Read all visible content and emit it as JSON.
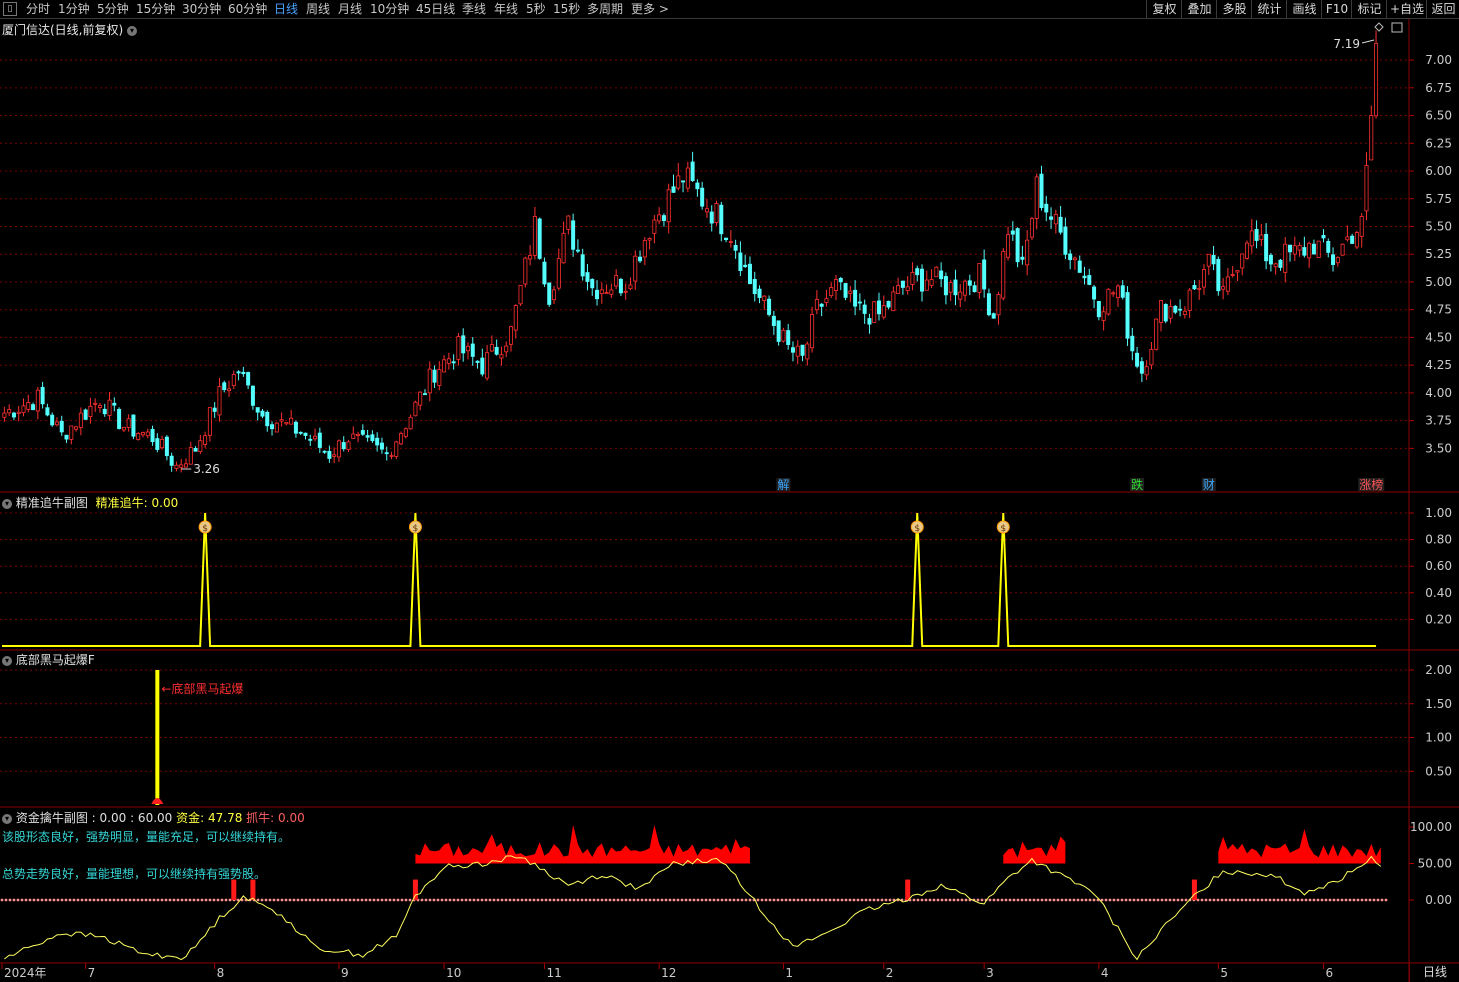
{
  "toolbar": {
    "periods": [
      "分时",
      "1分钟",
      "5分钟",
      "15分钟",
      "30分钟",
      "60分钟",
      "日线",
      "周线",
      "月线",
      "10分钟",
      "45日线",
      "季线",
      "年线",
      "5秒",
      "15秒",
      "多周期",
      "更多 >"
    ],
    "active_period": "日线",
    "right_buttons": [
      "复权",
      "叠加",
      "多股",
      "统计",
      "画线",
      "F10",
      "标记",
      "+自选",
      "返回"
    ]
  },
  "colors": {
    "up": "#ff3030",
    "down": "#54ffff",
    "grid": "#7a0000",
    "axis": "#8a0000",
    "yellow": "#ffff00",
    "indicator": "#ffff60",
    "white_line": "#e0e0e0"
  },
  "main_panel": {
    "title": "厦门信达(日线,前复权)",
    "high_label": "7.19",
    "low_label": "3.26",
    "event_badges": [
      {
        "text": "解",
        "index": 163,
        "color": "#3aa7ff"
      },
      {
        "text": "跌",
        "index": 237,
        "color": "#33dd33"
      },
      {
        "text": "财",
        "index": 252,
        "color": "#3aa7ff"
      },
      {
        "text": "涨榜",
        "index": 286,
        "color": "#ff5555"
      }
    ]
  },
  "panel2": {
    "title": "精准追牛副图",
    "indicator_label": "精准追牛: 0.00",
    "signal_icon": "money-bag-icon"
  },
  "panel3": {
    "title": "底部黑马起爆F",
    "annotation": "←底部黑马起爆"
  },
  "panel4": {
    "title": "资金擒牛副图",
    "v1": ": 0.00",
    "v2": ": 60.00",
    "capital_label": "资金: 47.78",
    "grab_label": "抓牛: 0.00",
    "comment1": "该股形态良好，强势明显，量能充足，可以继续持有。",
    "comment2": "总势走势良好，量能理想，可以继续持有强势股。"
  },
  "bottom_right_label": "日线",
  "chart_data": [
    {
      "type": "candlestick",
      "name": "厦门信达 日线",
      "ylim": [
        3.26,
        7.19
      ],
      "y_ticks": [
        3.5,
        3.75,
        4.0,
        4.25,
        4.5,
        4.75,
        5.0,
        5.25,
        5.5,
        5.75,
        6.0,
        6.25,
        6.5,
        6.75,
        7.0
      ],
      "x_ticks": [
        {
          "label": "2024年",
          "index": 0
        },
        {
          "label": "7",
          "index": 17
        },
        {
          "label": "8",
          "index": 44
        },
        {
          "label": "9",
          "index": 70
        },
        {
          "label": "10",
          "index": 92
        },
        {
          "label": "11",
          "index": 113
        },
        {
          "label": "12",
          "index": 137
        },
        {
          "label": "1",
          "index": 163
        },
        {
          "label": "2",
          "index": 184
        },
        {
          "label": "3",
          "index": 205
        },
        {
          "label": "4",
          "index": 229
        },
        {
          "label": "5",
          "index": 254
        },
        {
          "label": "6",
          "index": 276
        }
      ],
      "key_points": [
        {
          "index": 0,
          "close": 3.82
        },
        {
          "index": 7,
          "close": 3.95
        },
        {
          "index": 12,
          "close": 3.62
        },
        {
          "index": 20,
          "close": 3.95
        },
        {
          "index": 25,
          "close": 3.7
        },
        {
          "index": 31,
          "close": 3.6
        },
        {
          "index": 36,
          "close": 3.34
        },
        {
          "index": 40,
          "close": 3.5
        },
        {
          "index": 45,
          "close": 3.98
        },
        {
          "index": 49,
          "close": 4.2
        },
        {
          "index": 54,
          "close": 3.8
        },
        {
          "index": 62,
          "close": 3.65
        },
        {
          "index": 68,
          "close": 3.45
        },
        {
          "index": 72,
          "close": 3.6
        },
        {
          "index": 80,
          "close": 3.45
        },
        {
          "index": 85,
          "close": 3.8
        },
        {
          "index": 90,
          "close": 4.2
        },
        {
          "index": 95,
          "close": 4.4
        },
        {
          "index": 100,
          "close": 4.25
        },
        {
          "index": 106,
          "close": 4.55
        },
        {
          "index": 111,
          "close": 5.5
        },
        {
          "index": 114,
          "close": 4.9
        },
        {
          "index": 118,
          "close": 5.5
        },
        {
          "index": 123,
          "close": 4.95
        },
        {
          "index": 130,
          "close": 5.0
        },
        {
          "index": 135,
          "close": 5.5
        },
        {
          "index": 142,
          "close": 5.95
        },
        {
          "index": 147,
          "close": 5.7
        },
        {
          "index": 152,
          "close": 5.45
        },
        {
          "index": 156,
          "close": 5.0
        },
        {
          "index": 160,
          "close": 4.7
        },
        {
          "index": 164,
          "close": 4.4
        },
        {
          "index": 167,
          "close": 4.3
        },
        {
          "index": 170,
          "close": 4.75
        },
        {
          "index": 174,
          "close": 4.95
        },
        {
          "index": 178,
          "close": 4.75
        },
        {
          "index": 183,
          "close": 4.7
        },
        {
          "index": 188,
          "close": 4.95
        },
        {
          "index": 193,
          "close": 5.05
        },
        {
          "index": 198,
          "close": 4.95
        },
        {
          "index": 204,
          "close": 5.05
        },
        {
          "index": 207,
          "close": 4.7
        },
        {
          "index": 210,
          "close": 5.5
        },
        {
          "index": 213,
          "close": 5.1
        },
        {
          "index": 216,
          "close": 5.85
        },
        {
          "index": 220,
          "close": 5.5
        },
        {
          "index": 225,
          "close": 5.15
        },
        {
          "index": 229,
          "close": 4.8
        },
        {
          "index": 233,
          "close": 4.95
        },
        {
          "index": 236,
          "close": 4.4
        },
        {
          "index": 238,
          "close": 4.2
        },
        {
          "index": 242,
          "close": 4.75
        },
        {
          "index": 247,
          "close": 4.8
        },
        {
          "index": 252,
          "close": 5.15
        },
        {
          "index": 255,
          "close": 4.85
        },
        {
          "index": 260,
          "close": 5.45
        },
        {
          "index": 265,
          "close": 5.2
        },
        {
          "index": 270,
          "close": 5.25
        },
        {
          "index": 274,
          "close": 5.35
        },
        {
          "index": 278,
          "close": 5.2
        },
        {
          "index": 282,
          "close": 5.45
        },
        {
          "index": 284,
          "close": 5.5
        },
        {
          "index": 285,
          "close": 6.05
        },
        {
          "index": 286,
          "close": 6.5
        },
        {
          "index": 287,
          "close": 7.15
        }
      ]
    },
    {
      "type": "line",
      "name": "精准追牛",
      "ylim": [
        0,
        1.05
      ],
      "y_ticks": [
        0.2,
        0.4,
        0.6,
        0.8,
        1.0
      ],
      "spike_indices": [
        42,
        86,
        191,
        209
      ],
      "spike_value": 1.0,
      "baseline_value": 0.0
    },
    {
      "type": "bar",
      "name": "底部黑马起爆F",
      "ylim": [
        0,
        2.2
      ],
      "y_ticks": [
        0.5,
        1.0,
        1.5,
        2.0
      ],
      "bars": [
        {
          "index": 32,
          "value": 2.0
        }
      ]
    },
    {
      "type": "area",
      "name": "资金擒牛副图",
      "ylim": [
        -100,
        110
      ],
      "y_ticks": [
        0.0,
        50.0,
        100.0
      ],
      "grab_bar_indices": [
        48,
        52,
        86,
        189,
        249
      ],
      "grab_bar_value": 28,
      "capital_keypoints": [
        {
          "index": 0,
          "value": -80
        },
        {
          "index": 12,
          "value": -45
        },
        {
          "index": 20,
          "value": -50
        },
        {
          "index": 30,
          "value": -75
        },
        {
          "index": 38,
          "value": -78
        },
        {
          "index": 45,
          "value": -25
        },
        {
          "index": 50,
          "value": 5
        },
        {
          "index": 58,
          "value": -20
        },
        {
          "index": 65,
          "value": -65
        },
        {
          "index": 75,
          "value": -75
        },
        {
          "index": 82,
          "value": -50
        },
        {
          "index": 86,
          "value": 5
        },
        {
          "index": 92,
          "value": 45
        },
        {
          "index": 100,
          "value": 50
        },
        {
          "index": 108,
          "value": 60
        },
        {
          "index": 118,
          "value": 20
        },
        {
          "index": 125,
          "value": 35
        },
        {
          "index": 133,
          "value": 15
        },
        {
          "index": 140,
          "value": 50
        },
        {
          "index": 150,
          "value": 55
        },
        {
          "index": 158,
          "value": -10
        },
        {
          "index": 165,
          "value": -65
        },
        {
          "index": 172,
          "value": -45
        },
        {
          "index": 180,
          "value": -15
        },
        {
          "index": 188,
          "value": 0
        },
        {
          "index": 196,
          "value": 20
        },
        {
          "index": 205,
          "value": -5
        },
        {
          "index": 210,
          "value": 30
        },
        {
          "index": 215,
          "value": 55
        },
        {
          "index": 222,
          "value": 30
        },
        {
          "index": 228,
          "value": 10
        },
        {
          "index": 234,
          "value": -50
        },
        {
          "index": 237,
          "value": -80
        },
        {
          "index": 243,
          "value": -35
        },
        {
          "index": 249,
          "value": 5
        },
        {
          "index": 255,
          "value": 40
        },
        {
          "index": 265,
          "value": 35
        },
        {
          "index": 272,
          "value": 10
        },
        {
          "index": 280,
          "value": 30
        },
        {
          "index": 286,
          "value": 60
        },
        {
          "index": 288,
          "value": 45
        }
      ],
      "red_area_segments": [
        {
          "start": 86,
          "end": 156
        },
        {
          "start": 209,
          "end": 222
        },
        {
          "start": 254,
          "end": 288
        }
      ]
    }
  ]
}
